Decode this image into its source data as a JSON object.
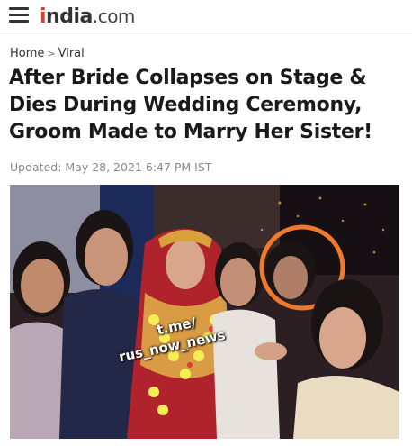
{
  "header": {
    "brand_prefix": "i",
    "brand_main": "ndia",
    "brand_tld": ".com",
    "menu_icon": "hamburger-icon"
  },
  "breadcrumb": {
    "home": "Home",
    "separator": ">",
    "section": "Viral"
  },
  "article": {
    "headline": "After Bride Collapses on Stage & Dies During Wedding Ceremony, Groom Made to Marry Her Sister!",
    "updated": "Updated: May 28, 2021 6:47 PM IST",
    "image_watermark_line1": "t.me/",
    "image_watermark_line2": "rus_now_news"
  },
  "colors": {
    "brand_accent": "#e63a2e",
    "highlight_circle": "#f07a2a"
  }
}
